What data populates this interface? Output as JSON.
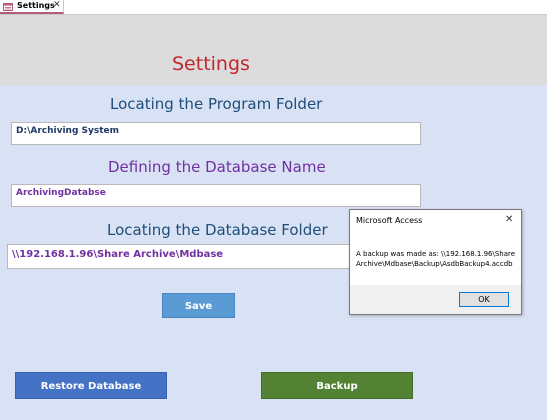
{
  "tab": {
    "label": "Settings",
    "close": "✕"
  },
  "header": {
    "title": "Settings"
  },
  "sections": {
    "program_folder_label": "Locating the Program Folder",
    "program_folder_value": "D:\\Archiving System",
    "database_name_label": "Defining the Database Name",
    "database_name_value": "ArchivingDatabse",
    "database_folder_label": "Locating the Database Folder",
    "database_folder_value": "\\\\192.168.1.96\\Share Archive\\Mdbase"
  },
  "buttons": {
    "save": "Save",
    "restore": "Restore Database",
    "backup": "Backup"
  },
  "dialog": {
    "title": "Microsoft Access",
    "close": "✕",
    "message_line1": "A backup was made as: \\\\192.168.1.96\\Share",
    "message_line2": "Archive\\Mdbase\\Backup\\AsdbBackup4.accdb",
    "ok": "OK"
  },
  "colors": {
    "title_red": "#c0262d",
    "label_blue": "#1f4e79",
    "label_purple": "#7030a0",
    "save_blue": "#5b9bd5",
    "restore_blue": "#4472c4",
    "backup_green": "#548235"
  },
  "icons": {
    "tab_icon": "form-icon",
    "tab_close": "close-icon",
    "dialog_close": "close-icon"
  }
}
